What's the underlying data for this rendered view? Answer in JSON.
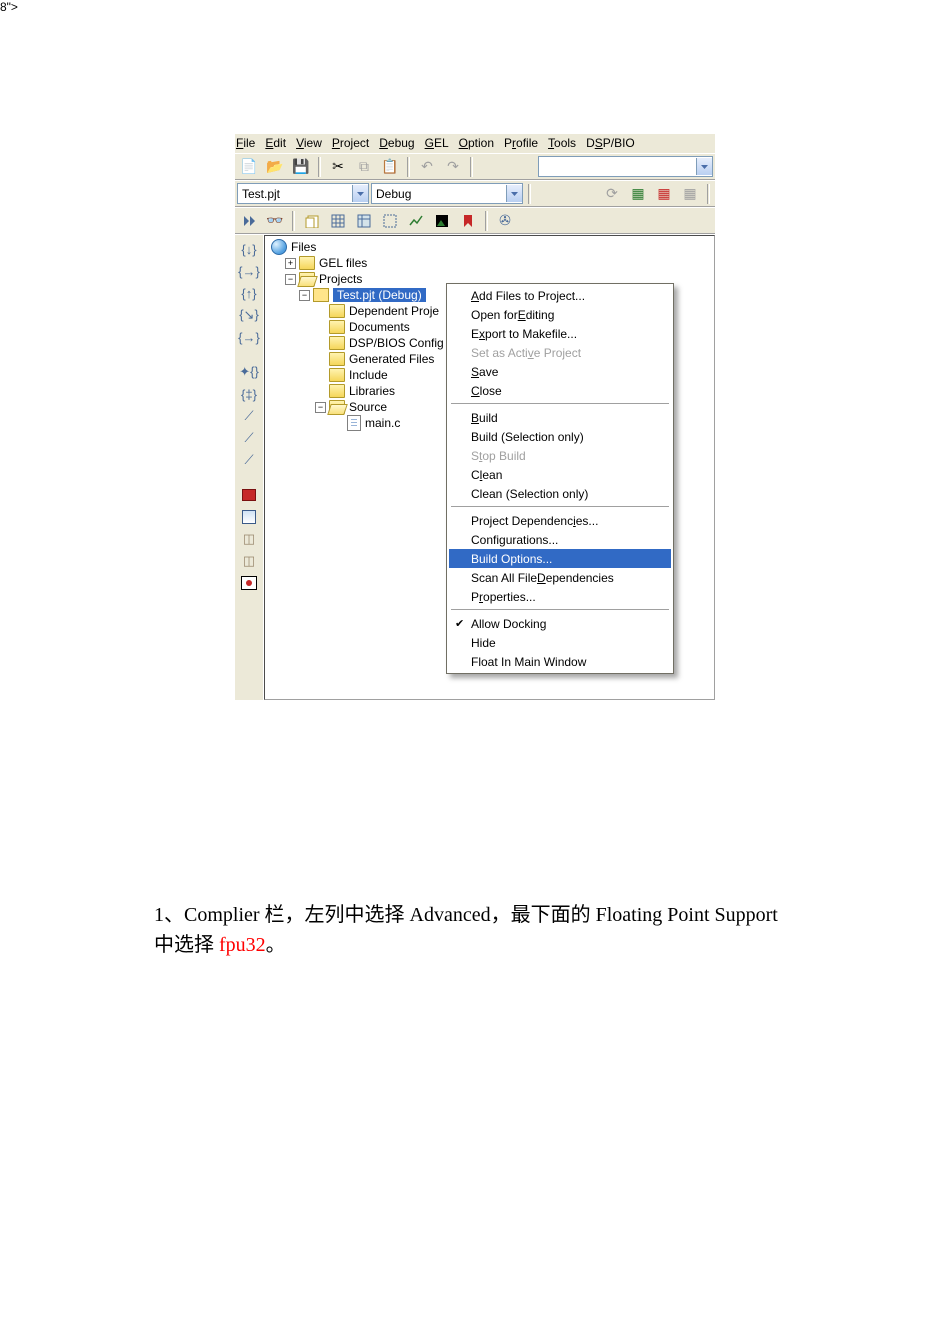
{
  "menubar": {
    "items": [
      {
        "pre": "",
        "u": "F",
        "post": "ile"
      },
      {
        "pre": "",
        "u": "E",
        "post": "dit"
      },
      {
        "pre": "",
        "u": "V",
        "post": "iew"
      },
      {
        "pre": "",
        "u": "P",
        "post": "roject"
      },
      {
        "pre": "",
        "u": "D",
        "post": "ebug"
      },
      {
        "pre": "",
        "u": "G",
        "post": "EL"
      },
      {
        "pre": "",
        "u": "O",
        "post": "ption"
      },
      {
        "pre": "P",
        "u": "r",
        "post": "ofile"
      },
      {
        "pre": "",
        "u": "T",
        "post": "ools"
      },
      {
        "pre": "D",
        "u": "S",
        "post": "P/BIO"
      }
    ]
  },
  "toolbar2": {
    "project": "Test.pjt",
    "config": "Debug"
  },
  "tree": {
    "root": "Files",
    "gel": "GEL files",
    "projects": "Projects",
    "testpjt": "Test.pjt  (Debug)",
    "deps": "Dependent Proje",
    "docs": "Documents",
    "dspbios": "DSP/BIOS Confi",
    "gen": "Generated Files",
    "include": "Include",
    "libs": "Libraries",
    "source": "Source",
    "mainc": "main.c"
  },
  "context_menu": {
    "add_files": {
      "pre": "",
      "u": "A",
      "post": "dd Files to Project..."
    },
    "open_edit": {
      "pre": "Open for ",
      "u": "E",
      "post": "diting"
    },
    "export_make": {
      "pre": "E",
      "u": "x",
      "post": "port to Makefile..."
    },
    "set_active": {
      "pre": "Set as Acti",
      "u": "v",
      "post": "e Project"
    },
    "save": {
      "pre": "",
      "u": "S",
      "post": "ave"
    },
    "close": {
      "pre": "",
      "u": "C",
      "post": "lose"
    },
    "build": {
      "pre": "",
      "u": "B",
      "post": "uild"
    },
    "build_sel": "Build (Selection only)",
    "stop_build": {
      "pre": "S",
      "u": "t",
      "post": "op Build"
    },
    "clean": {
      "pre": "C",
      "u": "l",
      "post": "ean"
    },
    "clean_sel": "Clean (Selection only)",
    "proj_deps": {
      "pre": "Project Dependenc",
      "u": "i",
      "post": "es..."
    },
    "configs": "Configurations...",
    "build_opts": "Build Options...",
    "scan_deps": {
      "pre": "Scan All File ",
      "u": "D",
      "post": "ependencies"
    },
    "properties": {
      "pre": "P",
      "u": "r",
      "post": "operties..."
    },
    "allow_dock": "Allow Docking",
    "hide": "Hide",
    "float": "Float In Main Window"
  },
  "paragraph": {
    "prefix": "1、Complier 栏，左列中选择 Advanced，最下面的 Floating Point Support 中选择 ",
    "red": "fpu32",
    "suffix": "。"
  }
}
